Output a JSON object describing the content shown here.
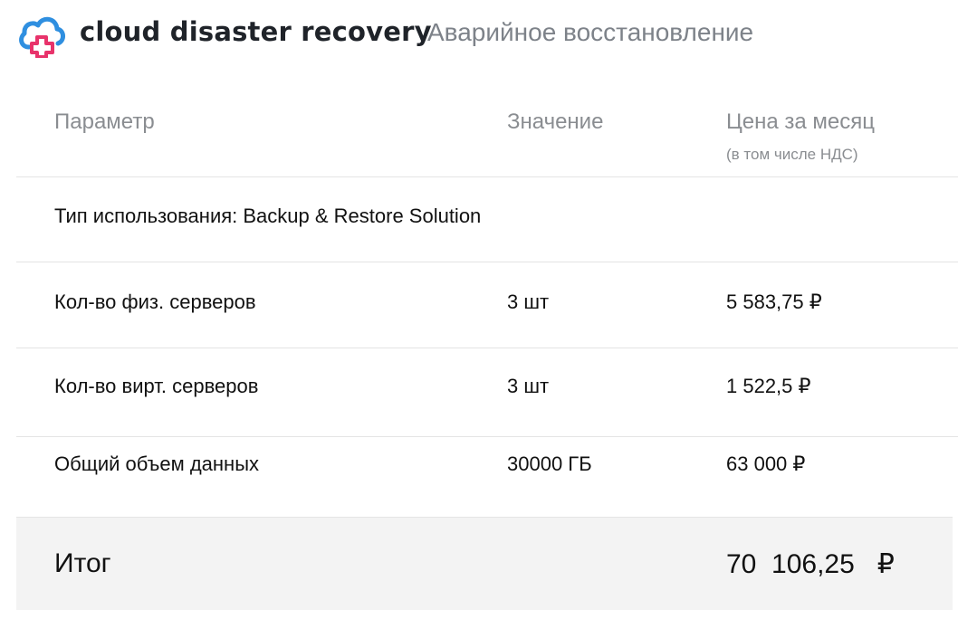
{
  "header": {
    "brand": "cloud disaster recovery",
    "subtitle": "Аварийное восстановление",
    "logo_icon": "cloud-cross-icon",
    "colors": {
      "cloud": "#2f8fe0",
      "cross": "#e8336b"
    }
  },
  "table": {
    "headers": {
      "param": "Параметр",
      "value": "Значение",
      "price": "Цена за месяц",
      "price_note": "(в том числе НДС)"
    },
    "usage_type": "Тип использования: Backup & Restore Solution",
    "rows": [
      {
        "param": "Кол-во физ. серверов",
        "value": "3 шт",
        "price": "5 583,75 ₽"
      },
      {
        "param": "Кол-во вирт. серверов",
        "value": "3 шт",
        "price": "1 522,5 ₽"
      },
      {
        "param": "Общий объем данных",
        "value": "30000 ГБ",
        "price": "63 000 ₽"
      }
    ],
    "total": {
      "label": "Итог",
      "value": "70  106,25   ₽"
    }
  }
}
